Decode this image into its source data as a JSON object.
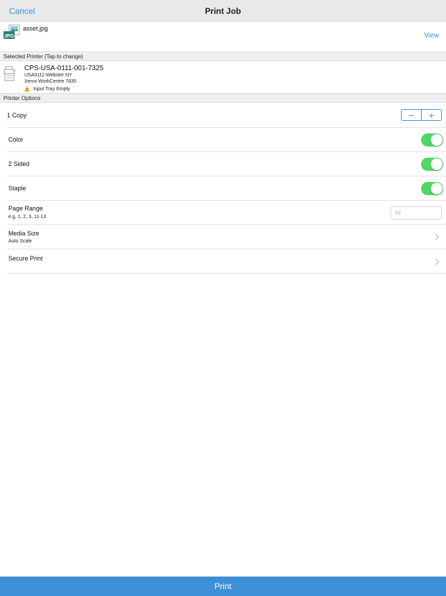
{
  "navbar": {
    "cancel_label": "Cancel",
    "title": "Print Job"
  },
  "file": {
    "name": "asset.jpg",
    "icon_label": "JPG",
    "view_label": "View"
  },
  "selected_printer": {
    "header": "Selected Printer (Tap to change)",
    "name": "CPS-USA-0111-001-7325",
    "location": "USA0111-Webster NY",
    "model": "Xerox WorkCentre 7835",
    "warning": "Input Tray Empty"
  },
  "options": {
    "header": "Printer Options",
    "copies_label": "1 Copy",
    "stepper_minus": "−",
    "stepper_plus": "+",
    "color_label": "Color",
    "color_on": true,
    "two_sided_label": "2 Sided",
    "two_sided_on": true,
    "staple_label": "Staple",
    "staple_on": true,
    "page_range_label": "Page Range",
    "page_range_hint": "e.g. 1, 2, 3, 11-13",
    "page_range_placeholder": "All",
    "media_size_label": "Media Size",
    "media_size_value": "Auto Scale",
    "secure_print_label": "Secure Print"
  },
  "print_label": "Print",
  "colors": {
    "accent": "#3d8fd6",
    "toggle_on": "#4cd964",
    "warning": "#f5c518"
  }
}
